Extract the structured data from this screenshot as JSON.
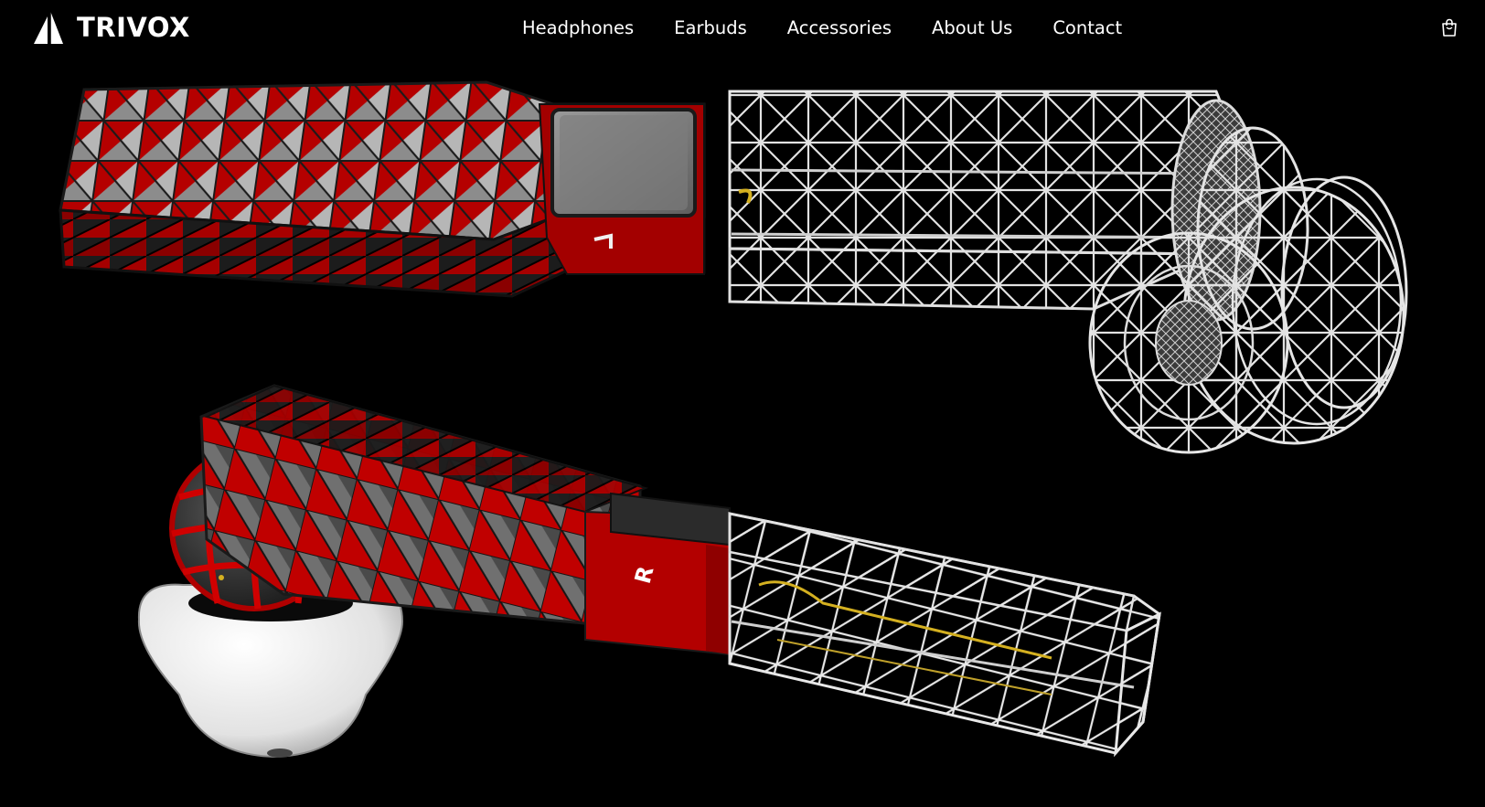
{
  "brand": {
    "name": "TRIVOX",
    "logo_icon": "sail-logo-icon"
  },
  "nav": {
    "items": [
      {
        "label": "Headphones"
      },
      {
        "label": "Earbuds"
      },
      {
        "label": "Accessories"
      },
      {
        "label": "About Us"
      },
      {
        "label": "Contact"
      }
    ]
  },
  "cart": {
    "icon": "shopping-bag-icon"
  },
  "hero": {
    "earbud_side_marking": "R",
    "colors": {
      "background": "#000000",
      "shell_red": "#b00000",
      "shell_gray": "#8a8a8a",
      "shell_dark": "#2a2a2a",
      "wireframe": "#e8e8e8",
      "tip_white": "#f2f2f2",
      "wire_gold": "#d4b020"
    }
  }
}
